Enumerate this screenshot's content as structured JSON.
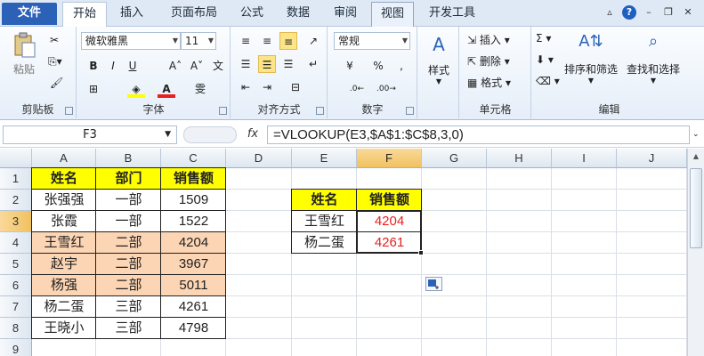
{
  "tabs": [
    {
      "label": "文件"
    },
    {
      "label": "开始"
    },
    {
      "label": "插入"
    },
    {
      "label": "页面布局"
    },
    {
      "label": "公式"
    },
    {
      "label": "数据"
    },
    {
      "label": "审阅"
    },
    {
      "label": "视图"
    },
    {
      "label": "开发工具"
    }
  ],
  "ribbon": {
    "clipboard": {
      "paste": "粘贴",
      "label": "剪贴板"
    },
    "font": {
      "name": "微软雅黑",
      "size": "11",
      "label": "字体"
    },
    "alignment": {
      "label": "对齐方式"
    },
    "number": {
      "format": "常规",
      "label": "数字"
    },
    "styles": {
      "label": "样式"
    },
    "cells": {
      "insert": "插入",
      "delete": "删除",
      "format": "格式",
      "label": "单元格"
    },
    "editing": {
      "sort": "排序和筛选",
      "find": "查找和选择",
      "label": "编辑"
    }
  },
  "formula_bar": {
    "name_box": "F3",
    "fx": "fx",
    "formula": "=VLOOKUP(E3,$A$1:$C$8,3,0)"
  },
  "columns": [
    "A",
    "B",
    "C",
    "D",
    "E",
    "F",
    "G",
    "H",
    "I",
    "J"
  ],
  "rows": [
    "1",
    "2",
    "3",
    "4",
    "5",
    "6",
    "7",
    "8",
    "9"
  ],
  "table1": {
    "header": [
      "姓名",
      "部门",
      "销售额"
    ],
    "rows": [
      [
        "张强强",
        "一部",
        "1509"
      ],
      [
        "张霞",
        "一部",
        "1522"
      ],
      [
        "王雪红",
        "二部",
        "4204"
      ],
      [
        "赵宇",
        "二部",
        "3967"
      ],
      [
        "杨强",
        "二部",
        "5011"
      ],
      [
        "杨二蛋",
        "三部",
        "4261"
      ],
      [
        "王晓小",
        "三部",
        "4798"
      ]
    ]
  },
  "table2": {
    "header": [
      "姓名",
      "销售额"
    ],
    "rows": [
      [
        "王雪红",
        "4204"
      ],
      [
        "杨二蛋",
        "4261"
      ]
    ]
  },
  "colors": {
    "header_fill": "#ffff00",
    "highlight_fill": "#fcd5b4",
    "result_text": "#e8201f",
    "accent": "#2b62b8"
  }
}
